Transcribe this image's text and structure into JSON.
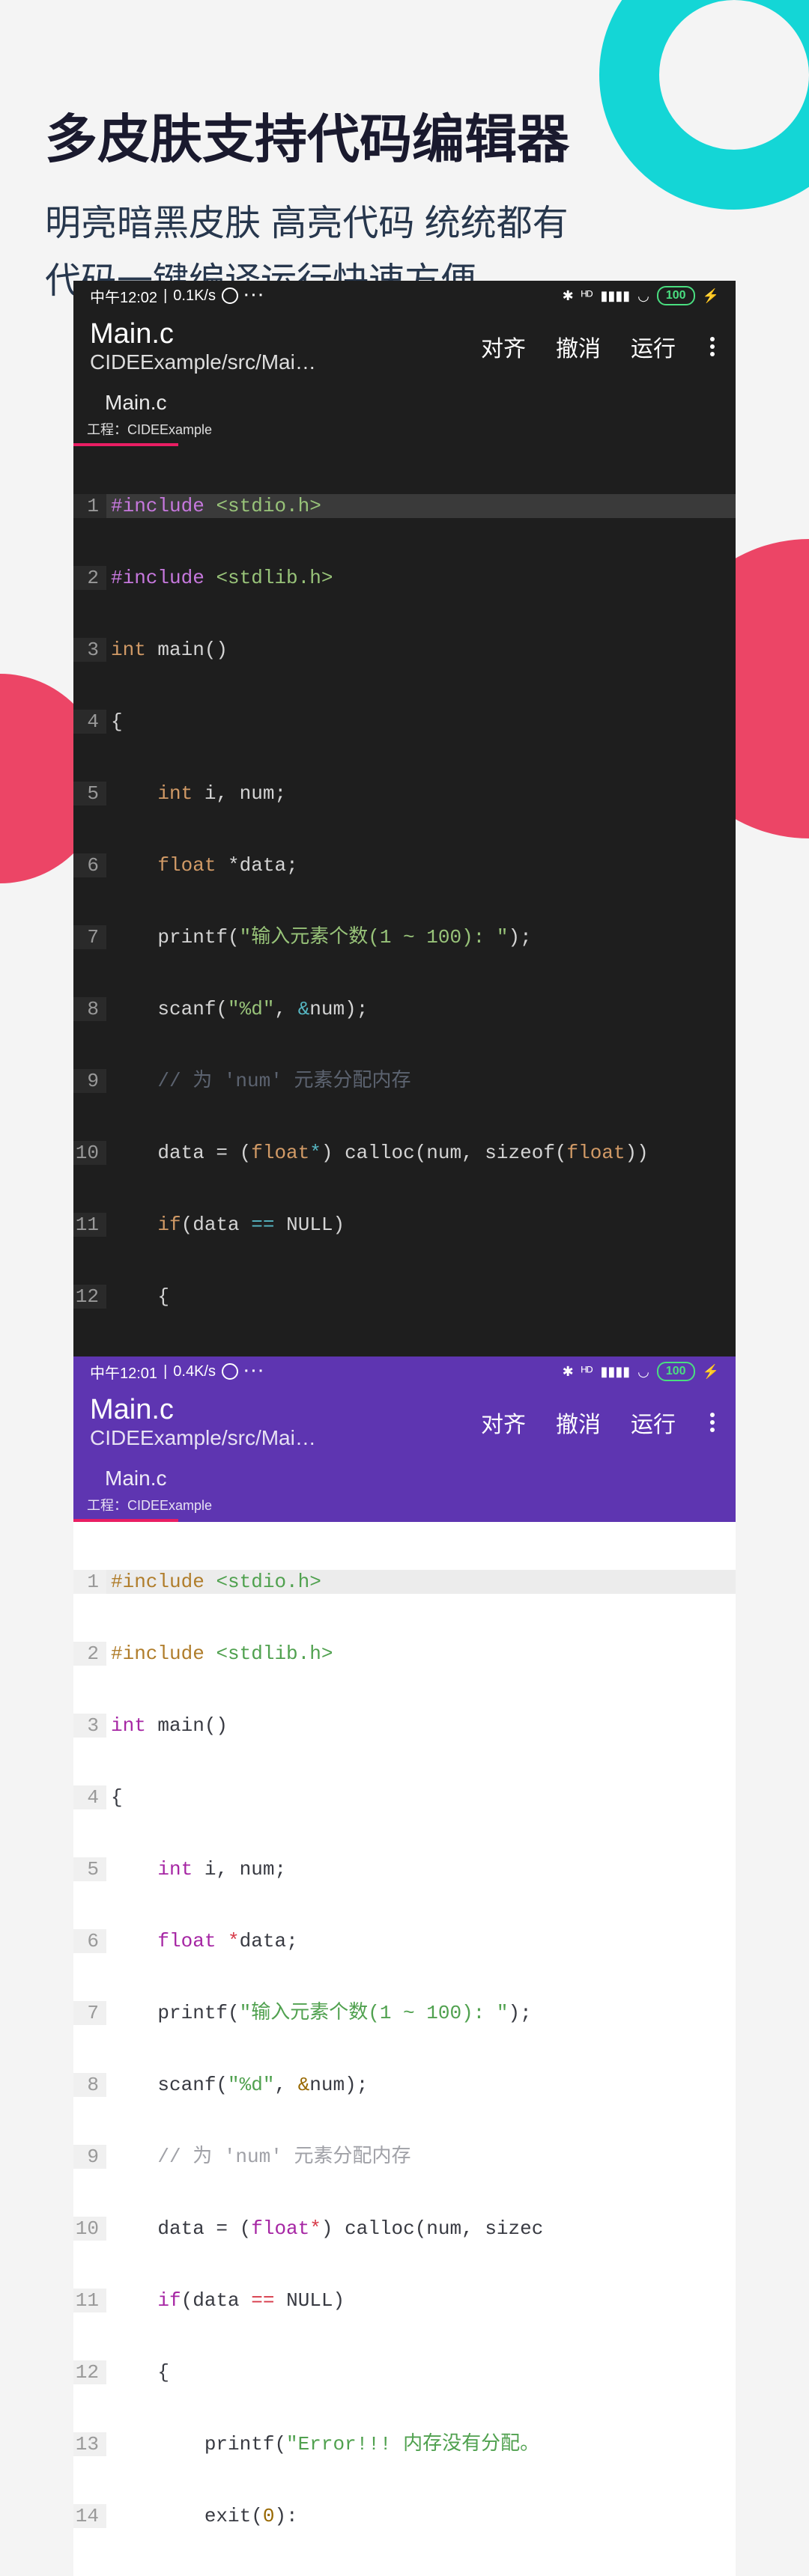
{
  "headline": {
    "title": "多皮肤支持代码编辑器",
    "line1": "明亮暗黑皮肤 高亮代码 统统都有",
    "line2": "代码一键编译运行快速方便"
  },
  "dark": {
    "status": {
      "time": "中午12:02",
      "speed": "0.1K/s",
      "battery": "100"
    },
    "appbar": {
      "title": "Main.c",
      "path": "CIDEExample/src/Mai…",
      "actions": {
        "align": "对齐",
        "undo": "撤消",
        "run": "运行"
      }
    },
    "tab": "Main.c",
    "project": "工程：CIDEExample",
    "lines": [
      "1",
      "2",
      "3",
      "4",
      "5",
      "6",
      "7",
      "8",
      "9",
      "10",
      "11",
      "12"
    ]
  },
  "light": {
    "status": {
      "time": "中午12:01",
      "speed": "0.4K/s",
      "battery": "100"
    },
    "appbar": {
      "title": "Main.c",
      "path": "CIDEExample/src/Mai…",
      "actions": {
        "align": "对齐",
        "undo": "撤消",
        "run": "运行"
      }
    },
    "tab": "Main.c",
    "project": "工程：CIDEExample",
    "lines": [
      "1",
      "2",
      "3",
      "4",
      "5",
      "6",
      "7",
      "8",
      "9",
      "10",
      "11",
      "12",
      "13",
      "14"
    ]
  },
  "code": {
    "include1_pre": "#include ",
    "include1_hdr": "<stdio.h>",
    "include2_pre": "#include ",
    "include2_hdr": "<stdlib.h>",
    "int": "int",
    "main_sig": " main()",
    "lbrace": "{",
    "int2": "int",
    "ivars": " i, num;",
    "float": "float",
    "star": " *",
    "data_decl": "data;",
    "printf": "printf(",
    "prompt_str": "\"输入元素个数(1 ~ 100): \"",
    "close_paren": ");",
    "scanf": "scanf(",
    "fmt_str": "\"%d\"",
    "comma_sp": ", ",
    "amp": "&",
    "num_close": "num);",
    "comment": "// 为 'num' 元素分配内存",
    "assign": "data = (",
    "float_cast": "float",
    "star_close": "*",
    "calloc": ") calloc(num, sizeof(",
    "float_arg": "float",
    "dark_tail": "))",
    "light_tail": ", sizec",
    "if_kw": "if",
    "if_open": "(data ",
    "eqeq": "==",
    "null_close": " NULL)",
    "lbrace2": "{",
    "printf2": "printf(",
    "err_str": "\"Error!!! 内存没有分配。",
    "exit": "exit(",
    "zero": "0",
    "exit_close": "):"
  }
}
